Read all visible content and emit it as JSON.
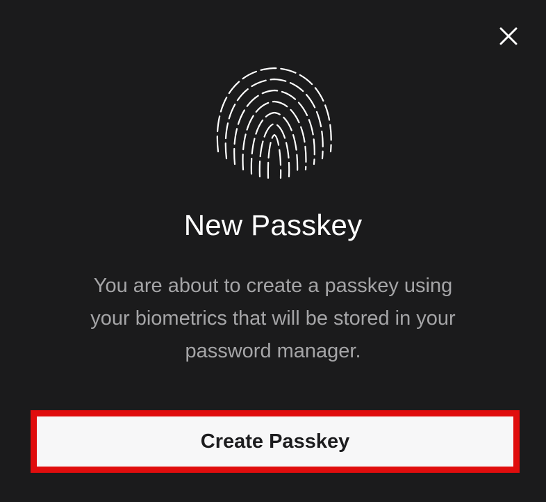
{
  "dialog": {
    "title": "New Passkey",
    "description": "You are about to create a passkey using your biometrics that will be stored in your password manager.",
    "primary_button_label": "Create Passkey",
    "close_icon": "close-icon",
    "illustration_icon": "fingerprint-icon"
  },
  "colors": {
    "background": "#1b1b1c",
    "title_text": "#ffffff",
    "description_text": "#a5a5a7",
    "button_background": "#f7f7f8",
    "button_text": "#1c1c1e",
    "highlight": "#e00d0d"
  }
}
